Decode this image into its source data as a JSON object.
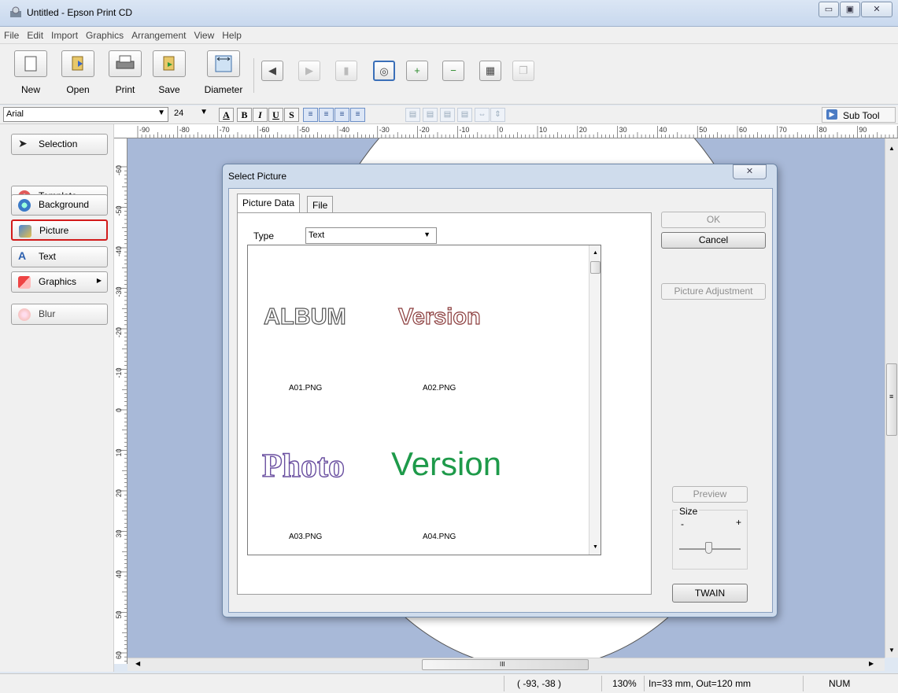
{
  "window": {
    "title": "Untitled - Epson Print CD",
    "controls": {
      "minimize": "▭",
      "maximize": "▣",
      "close": "✕"
    }
  },
  "menu": [
    "File",
    "Edit",
    "Import",
    "Graphics",
    "Arrangement",
    "View",
    "Help"
  ],
  "toolbar": {
    "new_label": "New",
    "open_label": "Open",
    "print_label": "Print",
    "save_label": "Save",
    "diameter_label": "Diameter"
  },
  "format_bar": {
    "font_name": "Arial",
    "font_size": "24",
    "sub_tool_label": "Sub Tool"
  },
  "tools": [
    {
      "label": "Selection",
      "icon": "arrow-cursor-icon"
    },
    {
      "label": "Template",
      "icon": "template-icon"
    },
    {
      "label": "Background",
      "icon": "background-icon"
    },
    {
      "label": "Picture",
      "icon": "picture-icon",
      "selected": true
    },
    {
      "label": "Text",
      "icon": "text-icon"
    },
    {
      "label": "Graphics",
      "icon": "graphics-icon"
    },
    {
      "label": "Blur",
      "icon": "blur-icon"
    }
  ],
  "ruler_top_labels": [
    "-90",
    "-80",
    "-70",
    "-60",
    "-50",
    "-40",
    "-30",
    "-20",
    "-10",
    "0",
    "10",
    "20",
    "30",
    "40",
    "50",
    "60",
    "70",
    "80",
    "90"
  ],
  "ruler_left_labels": [
    "-60",
    "-50",
    "-40",
    "-30",
    "-20",
    "-10",
    "0",
    "10",
    "20",
    "30",
    "40",
    "50",
    "60"
  ],
  "dialog": {
    "title": "Select Picture",
    "close": "✕",
    "tabs": [
      "Picture Data",
      "File"
    ],
    "type_label": "Type",
    "type_value": "Text",
    "ok_label": "OK",
    "cancel_label": "Cancel",
    "picture_adjustment_label": "Picture Adjustment",
    "preview_label": "Preview",
    "size_label": "Size",
    "size_minus": "-",
    "size_plus": "+",
    "twain_label": "TWAIN",
    "thumbnails": [
      {
        "text": "ALBUM",
        "file": "A01.PNG"
      },
      {
        "text": "Version",
        "file": "A02.PNG"
      },
      {
        "text": "Photo",
        "file": "A03.PNG"
      },
      {
        "text": "Version",
        "file": "A04.PNG"
      }
    ]
  },
  "status": {
    "coords": "( -93, -38 )",
    "zoom": "130%",
    "dimensions": "In=33 mm, Out=120 mm",
    "num": "NUM"
  },
  "scroll_marks": {
    "h_thumb": "III",
    "v_thumb": "≡"
  }
}
